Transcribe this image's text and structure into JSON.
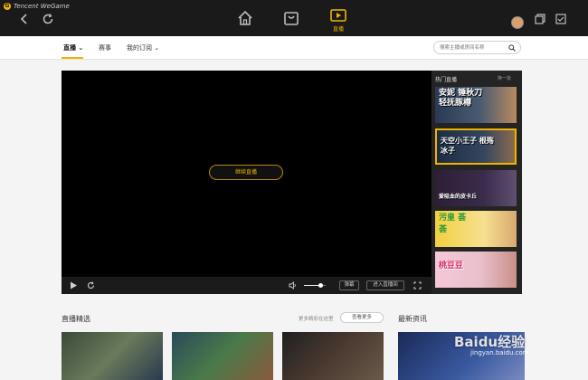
{
  "titlebar": {
    "brand": "Tencent WeGame",
    "live_label": "直播"
  },
  "subnav": {
    "tabs": [
      {
        "label": "直播 ⌄"
      },
      {
        "label": "赛事"
      },
      {
        "label": "我的订阅 ⌄"
      }
    ],
    "search_placeholder": "搜索主播或房间名称"
  },
  "player": {
    "resume_button": "继续直播",
    "danmaku_button": "弹幕",
    "enter_room_button": "进入直播间",
    "volume_level": 0.75
  },
  "sidebar": {
    "title": "热门直播",
    "refresh": "换一批",
    "items": [
      {
        "label": "安妮 锤秋刀 轻抚豚樽"
      },
      {
        "label": "天空小王子 根殇冰子"
      },
      {
        "label": "爱吸血的皮卡丘"
      },
      {
        "label": "污皇 荟荟"
      },
      {
        "label": "桃豆豆"
      }
    ]
  },
  "sections": {
    "featured_title": "直播精选",
    "featured_more_link": "更多精彩在这里",
    "featured_more_button": "查看更多",
    "news_title": "最新资讯"
  },
  "watermark": {
    "line1": "Baidu经验",
    "line2": "jingyan.baidu.com"
  }
}
